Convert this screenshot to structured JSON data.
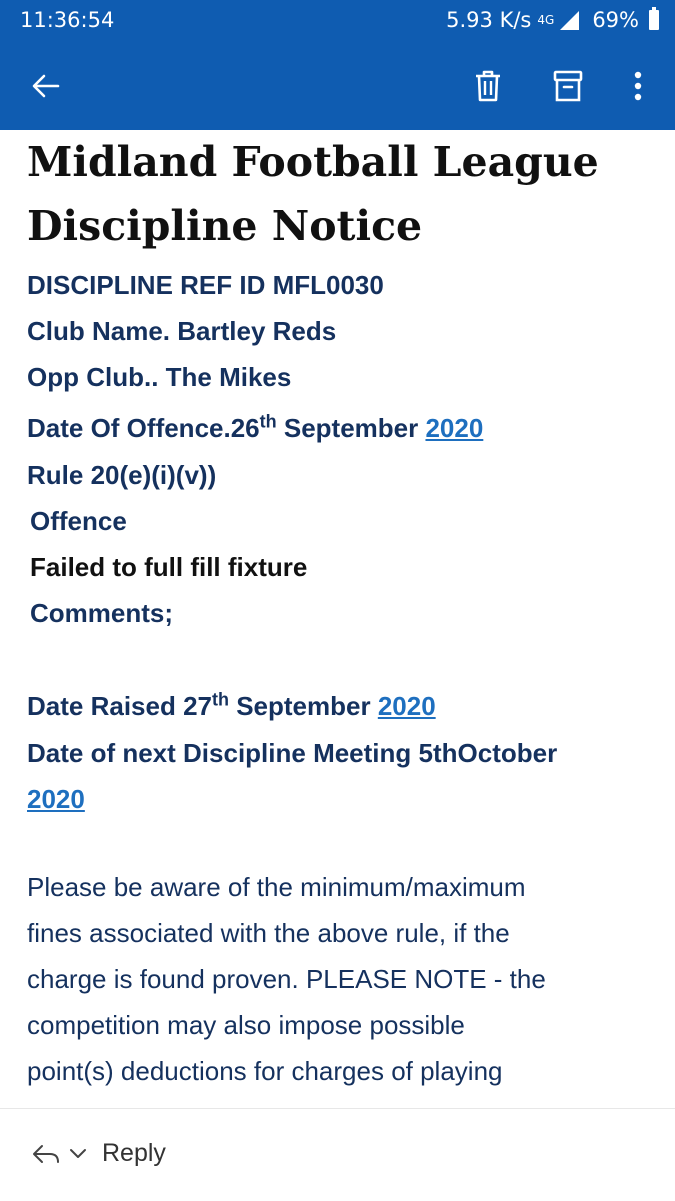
{
  "status_bar": {
    "time": "11:36:54",
    "net_speed": "5.93 K/s",
    "network_type": "4G",
    "battery": "69%"
  },
  "app_bar": {
    "icons": [
      "back-arrow-icon",
      "trash-icon",
      "archive-icon",
      "more-vert-icon"
    ],
    "color": "#0f5cb1"
  },
  "email": {
    "title_line1": "Midland Football League",
    "title_line2": "Discipline Notice",
    "ref": "DISCIPLINE REF ID MFL0030",
    "club": "Club Name. Bartley Reds",
    "opp_club": "Opp Club.. The Mikes",
    "offence_date_prefix": "Date Of Offence.26",
    "offence_date_sup": "th",
    "offence_date_month": " September ",
    "offence_date_year": "2020",
    "rule": "Rule 20(e)(i)(v))",
    "offence_label": "Offence",
    "offence_text": "Failed to full fill fixture",
    "comments_label": "Comments;",
    "raised_prefix": "Date Raised 27",
    "raised_sup": "th",
    "raised_month": " September ",
    "raised_year": "2020",
    "next_meeting": "Date of next Discipline Meeting 5thOctober",
    "next_meeting_year": "2020",
    "body_lines": [
      "Please be aware of the minimum/maximum",
      "fines associated with the above rule, if the",
      "charge is found proven. PLEASE NOTE - the",
      "competition may also impose possible",
      "point(s) deductions for charges of playing"
    ]
  },
  "reply_bar": {
    "reply_label": "Reply"
  }
}
